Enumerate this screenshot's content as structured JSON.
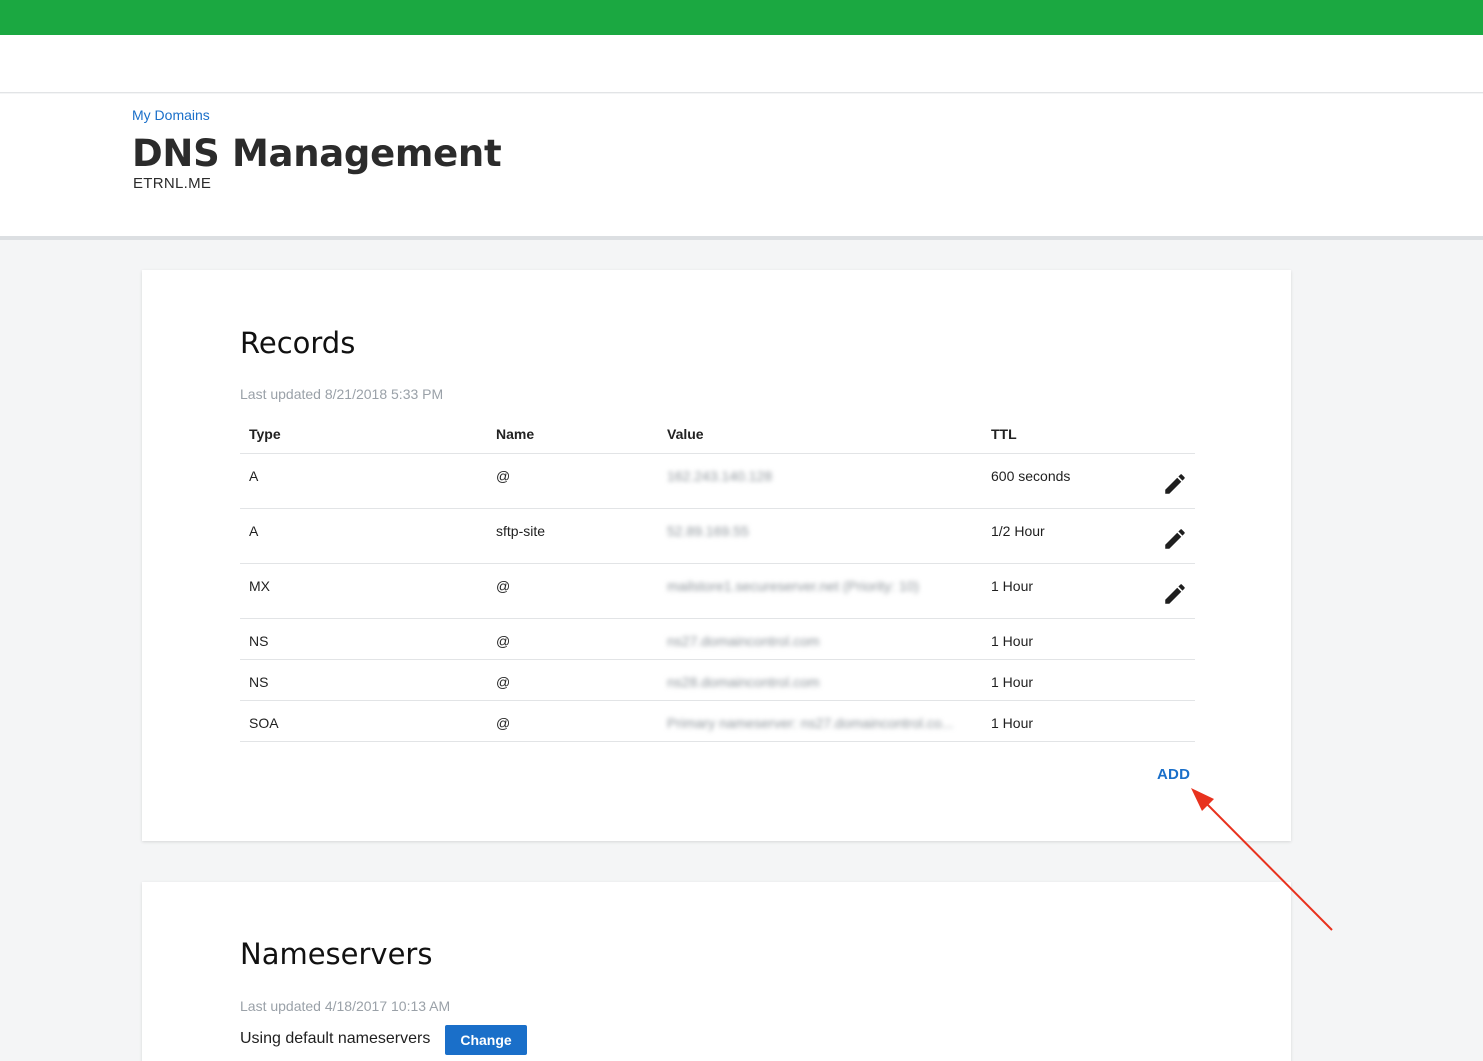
{
  "header": {
    "breadcrumb": "My Domains",
    "title": "DNS Management",
    "domain": "ETRNL.ME"
  },
  "records": {
    "title": "Records",
    "last_updated": "Last updated 8/21/2018 5:33 PM",
    "columns": {
      "type": "Type",
      "name": "Name",
      "value": "Value",
      "ttl": "TTL"
    },
    "rows": [
      {
        "type": "A",
        "name": "@",
        "value": "162.243.140.128",
        "ttl": "600 seconds",
        "editable": true
      },
      {
        "type": "A",
        "name": "sftp-site",
        "value": "52.89.169.55",
        "ttl": "1/2 Hour",
        "editable": true
      },
      {
        "type": "MX",
        "name": "@",
        "value": "mailstore1.secureserver.net (Priority: 10)",
        "ttl": "1 Hour",
        "editable": true
      },
      {
        "type": "NS",
        "name": "@",
        "value": "ns27.domaincontrol.com",
        "ttl": "1 Hour",
        "editable": false
      },
      {
        "type": "NS",
        "name": "@",
        "value": "ns28.domaincontrol.com",
        "ttl": "1 Hour",
        "editable": false
      },
      {
        "type": "SOA",
        "name": "@",
        "value": "Primary nameserver: ns27.domaincontrol.co...",
        "ttl": "1 Hour",
        "editable": false
      }
    ],
    "add_label": "ADD",
    "edit_icon": "pencil-icon"
  },
  "nameservers": {
    "title": "Nameservers",
    "last_updated": "Last updated 4/18/2017 10:13 AM",
    "status_text": "Using default nameservers",
    "change_label": "Change"
  },
  "colors": {
    "topbar": "#1ba841",
    "link": "#1a6fc9",
    "annotation_arrow": "#e8321e"
  }
}
